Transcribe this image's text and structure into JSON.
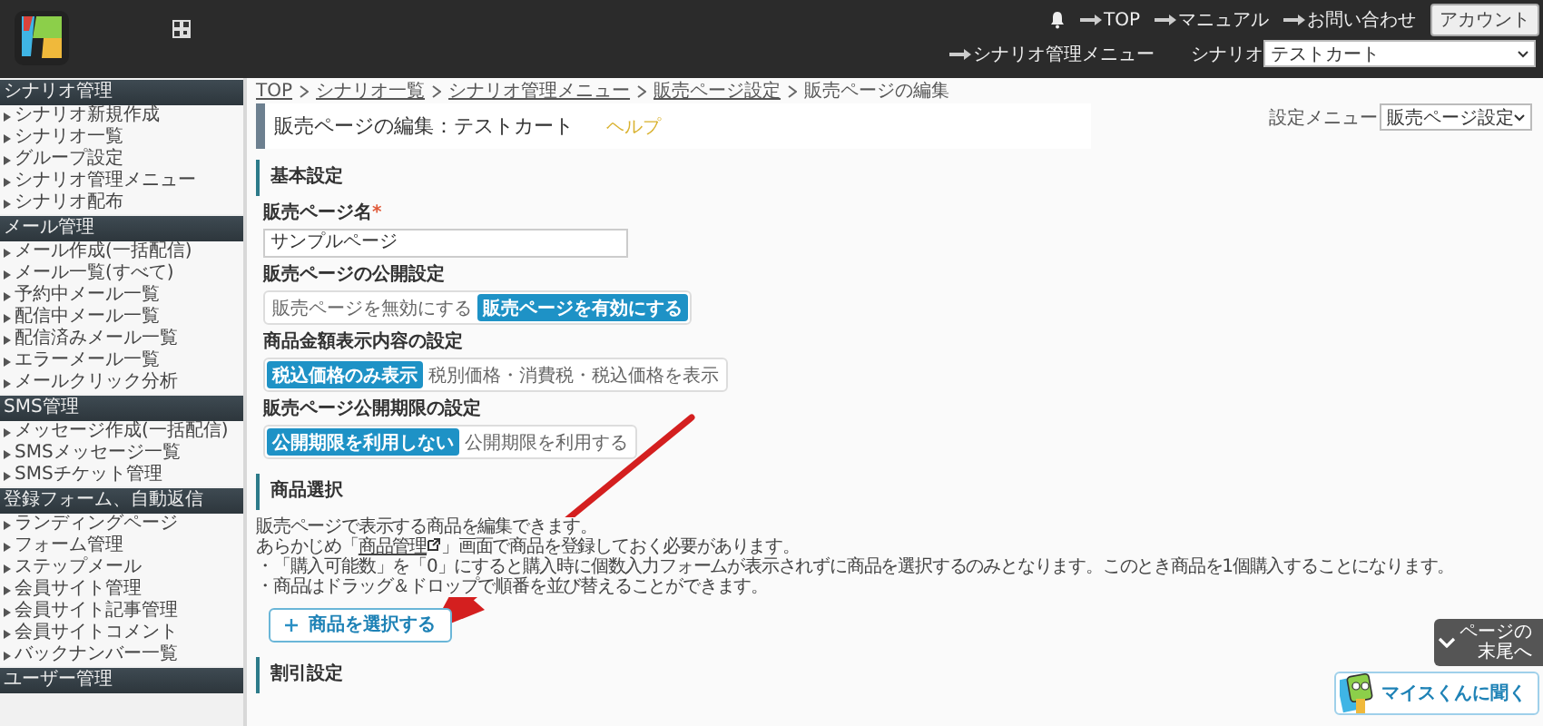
{
  "header": {
    "links": [
      "TOP",
      "マニュアル",
      "お問い合わせ"
    ],
    "account_button": "アカウント",
    "menu_link": "シナリオ管理メニュー",
    "scenario_label": "シナリオ",
    "scenario_value": "テストカート"
  },
  "sidebar": [
    {
      "title": "シナリオ管理",
      "items": [
        "シナリオ新規作成",
        "シナリオ一覧",
        "グループ設定",
        "シナリオ管理メニュー",
        "シナリオ配布"
      ]
    },
    {
      "title": "メール管理",
      "items": [
        "メール作成(一括配信)",
        "メール一覧(すべて)",
        "予約中メール一覧",
        "配信中メール一覧",
        "配信済みメール一覧",
        "エラーメール一覧",
        "メールクリック分析"
      ]
    },
    {
      "title": "SMS管理",
      "items": [
        "メッセージ作成(一括配信)",
        "SMSメッセージ一覧",
        "SMSチケット管理"
      ]
    },
    {
      "title": "登録フォーム、自動返信",
      "items": [
        "ランディングページ",
        "フォーム管理",
        "ステップメール",
        "会員サイト管理",
        "会員サイト記事管理",
        "会員サイトコメント",
        "バックナンバー一覧"
      ]
    },
    {
      "title": "ユーザー管理"
    }
  ],
  "breadcrumb": [
    {
      "label": "TOP",
      "link": true
    },
    {
      "label": "シナリオ一覧",
      "link": true
    },
    {
      "label": "シナリオ管理メニュー",
      "link": true
    },
    {
      "label": "販売ページ設定",
      "link": true
    },
    {
      "label": "販売ページの編集",
      "link": false
    }
  ],
  "settings_menu": {
    "label": "設定メニュー",
    "value": "販売ページ設定"
  },
  "page_title": "販売ページの編集：テストカート",
  "help_link": "ヘルプ",
  "basic": {
    "title": "基本設定",
    "name_label": "販売ページ名",
    "required_mark": "*",
    "name_value": "サンプルページ",
    "toggles": [
      {
        "label": "販売ページの公開設定",
        "options": [
          {
            "label": "販売ページを無効にする",
            "selected": false
          },
          {
            "label": "販売ページを有効にする",
            "selected": true
          }
        ]
      },
      {
        "label": "商品金額表示内容の設定",
        "options": [
          {
            "label": "税込価格のみ表示",
            "selected": true
          },
          {
            "label": "税別価格・消費税・税込価格を表示",
            "selected": false
          }
        ]
      },
      {
        "label": "販売ページ公開期限の設定",
        "options": [
          {
            "label": "公開期限を利用しない",
            "selected": true
          },
          {
            "label": "公開期限を利用する",
            "selected": false
          }
        ]
      }
    ]
  },
  "products": {
    "title": "商品選択",
    "line1": "販売ページで表示する商品を編集できます。",
    "line2_before": "あらかじめ「",
    "line2_link": "商品管理",
    "line2_after": "」画面で商品を登録しておく必要があります。",
    "notes": [
      "・「購入可能数」を「0」にすると購入時に個数入力フォームが表示されずに商品を選択するのみとなります。このとき商品を1個購入することになります。",
      "・商品はドラッグ＆ドロップで順番を並び替えることができます。"
    ],
    "add_button": "商品を選択する"
  },
  "discount_title": "割引設定",
  "scroll_button": [
    "ページの",
    "末尾へ"
  ],
  "chat_button": "マイスくんに聞く"
}
